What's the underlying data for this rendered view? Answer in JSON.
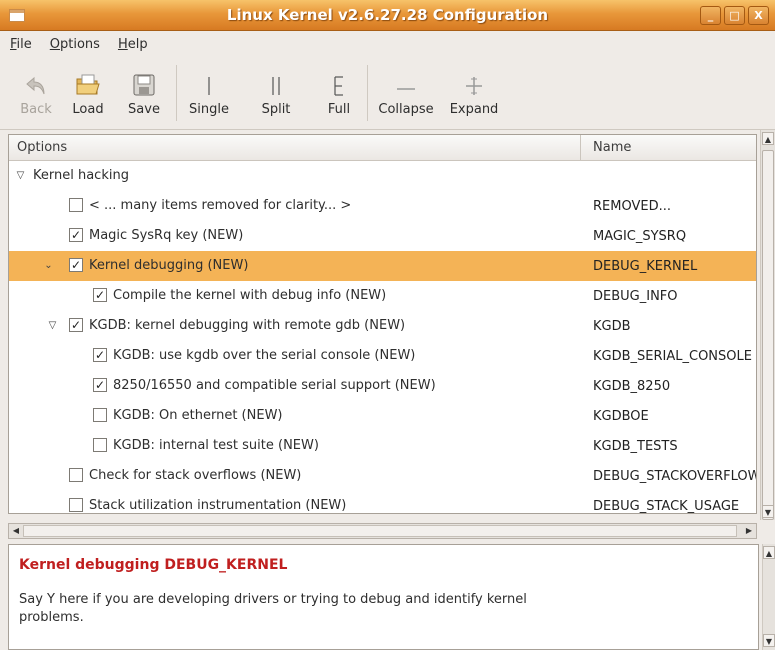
{
  "window": {
    "title": "Linux Kernel v2.6.27.28 Configuration",
    "buttons": [
      "_",
      "□",
      "X"
    ]
  },
  "menu": [
    "File",
    "Options",
    "Help"
  ],
  "toolbar": {
    "back": "Back",
    "load": "Load",
    "save": "Save",
    "single": "Single",
    "split": "Split",
    "full": "Full",
    "collapse": "Collapse",
    "expand": "Expand"
  },
  "tree": {
    "col_options": "Options",
    "col_name": "Name",
    "rows": [
      {
        "label": "Kernel hacking",
        "name": ""
      },
      {
        "label": "< ... many items removed for clarity... >",
        "name": "REMOVED...",
        "checked": false
      },
      {
        "label": "Magic SysRq key (NEW)",
        "name": "MAGIC_SYSRQ",
        "checked": true
      },
      {
        "label": "Kernel debugging (NEW)",
        "name": "DEBUG_KERNEL",
        "checked": true
      },
      {
        "label": "Compile the kernel with debug info (NEW)",
        "name": "DEBUG_INFO",
        "checked": true
      },
      {
        "label": "KGDB: kernel debugging with remote gdb (NEW)",
        "name": "KGDB",
        "checked": true
      },
      {
        "label": "KGDB: use kgdb over the serial console (NEW)",
        "name": "KGDB_SERIAL_CONSOLE",
        "checked": true
      },
      {
        "label": "8250/16550 and compatible serial support (NEW)",
        "name": "KGDB_8250",
        "checked": true
      },
      {
        "label": "KGDB: On ethernet (NEW)",
        "name": "KGDBOE",
        "checked": false
      },
      {
        "label": "KGDB: internal test suite (NEW)",
        "name": "KGDB_TESTS",
        "checked": false
      },
      {
        "label": "Check for stack overflows (NEW)",
        "name": "DEBUG_STACKOVERFLOW",
        "checked": false
      },
      {
        "label": "Stack utilization instrumentation (NEW)",
        "name": "DEBUG_STACK_USAGE",
        "checked": false
      }
    ]
  },
  "help": {
    "title": "Kernel debugging DEBUG_KERNEL",
    "text": "Say Y here if you are developing drivers or trying to debug and identify kernel problems."
  },
  "colors": {
    "titlebar": "#e8973a",
    "selected_row": "#f4b356",
    "help_title": "#c01f1f"
  }
}
